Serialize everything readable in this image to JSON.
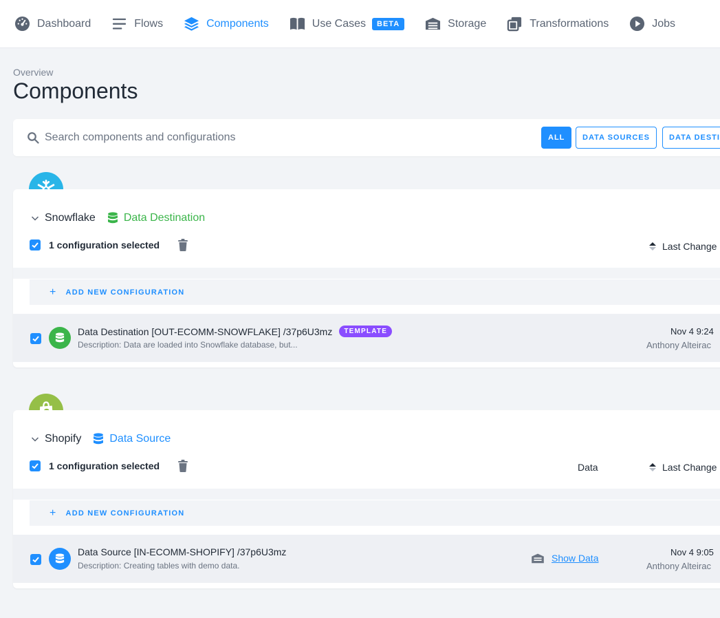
{
  "nav": {
    "items": [
      {
        "label": "Dashboard",
        "icon": "dashboard-icon"
      },
      {
        "label": "Flows",
        "icon": "flows-icon"
      },
      {
        "label": "Components",
        "icon": "layers-icon",
        "active": true
      },
      {
        "label": "Use Cases",
        "icon": "book-icon",
        "badge": "BETA"
      },
      {
        "label": "Storage",
        "icon": "storage-icon"
      },
      {
        "label": "Transformations",
        "icon": "transformations-icon"
      },
      {
        "label": "Jobs",
        "icon": "play-icon"
      }
    ]
  },
  "page": {
    "overline": "Overview",
    "title": "Components"
  },
  "search": {
    "placeholder": "Search components and configurations",
    "value": ""
  },
  "filters": [
    {
      "label": "ALL",
      "active": true
    },
    {
      "label": "DATA SOURCES",
      "active": false
    },
    {
      "label": "DATA DESTINATIONS",
      "active": false
    }
  ],
  "components": [
    {
      "name": "Snowflake",
      "logo": "snowflake-icon",
      "type_label": "Data Destination",
      "type_color": "#3bb54a",
      "selected_text": "1 configuration selected",
      "sort_label": "Last Change",
      "add_label": "ADD NEW CONFIGURATION",
      "config": {
        "title": "Data Destination [OUT-ECOMM-SNOWFLAKE] /37p6U3mz",
        "badge": "TEMPLATE",
        "description": "Description: Data are loaded into Snowflake database, but...",
        "date": "Nov 4 9:24",
        "author": "Anthony Alteirac"
      }
    },
    {
      "name": "Shopify",
      "logo": "shopify-icon",
      "type_label": "Data Source",
      "type_color": "#1f8fff",
      "selected_text": "1 configuration selected",
      "data_col_label": "Data",
      "sort_label": "Last Change",
      "add_label": "ADD NEW CONFIGURATION",
      "config": {
        "title": "Data Source [IN-ECOMM-SHOPIFY] /37p6U3mz",
        "description": "Description: Creating tables with demo data.",
        "show_data_label": "Show Data",
        "date": "Nov 4 9:05",
        "author": "Anthony Alteirac"
      }
    }
  ]
}
